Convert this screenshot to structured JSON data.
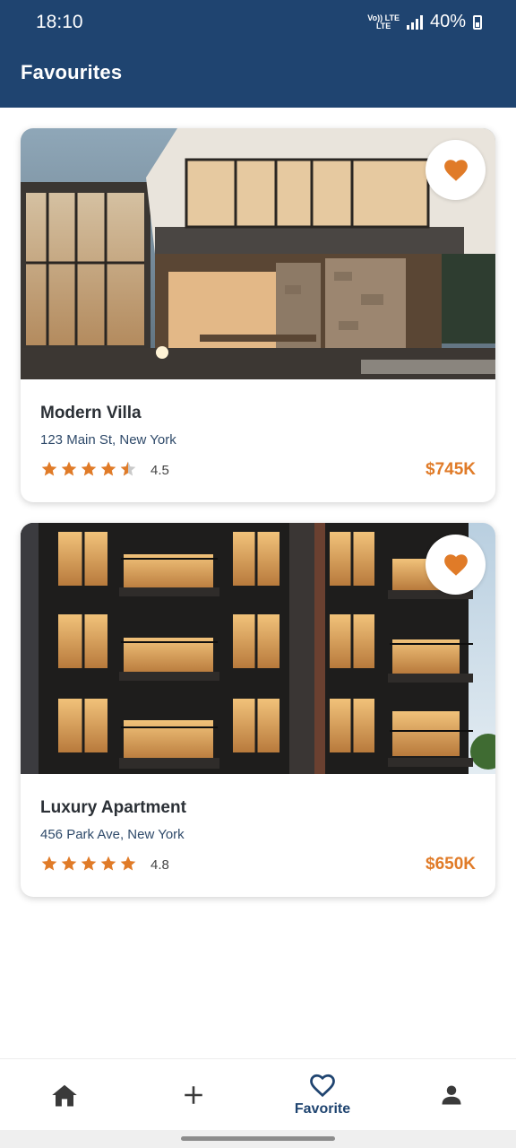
{
  "status_bar": {
    "time": "18:10",
    "network_top": "Vo)) LTE",
    "network_bottom": "LTE",
    "battery": "40%"
  },
  "app_bar": {
    "title": "Favourites"
  },
  "colors": {
    "primary": "#1f4470",
    "accent": "#e07b28",
    "star": "#e07b28"
  },
  "listings": [
    {
      "title": "Modern Villa",
      "address": "123 Main St, New York",
      "rating": "4.5",
      "rating_value": 4.5,
      "price": "$745K",
      "favorite_icon": "heart-filled-icon"
    },
    {
      "title": "Luxury Apartment",
      "address": "456 Park Ave, New York",
      "rating": "4.8",
      "rating_value": 4.8,
      "price": "$650K",
      "favorite_icon": "heart-filled-icon"
    }
  ],
  "bottom_nav": [
    {
      "icon": "home-icon",
      "label": ""
    },
    {
      "icon": "plus-icon",
      "label": ""
    },
    {
      "icon": "heart-outline-icon",
      "label": "Favorite",
      "active": true
    },
    {
      "icon": "person-icon",
      "label": ""
    }
  ]
}
